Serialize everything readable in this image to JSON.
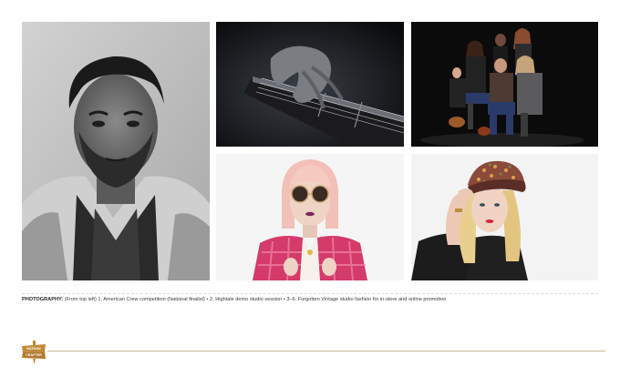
{
  "photos": [
    {
      "name": "photo-1-american-crew-portrait"
    },
    {
      "name": "photo-2-hightale-guitar"
    },
    {
      "name": "photo-3-forgotten-vintage-group"
    },
    {
      "name": "photo-4-forgotten-vintage-sunglasses"
    },
    {
      "name": "photo-5-forgotten-vintage-cap"
    }
  ],
  "caption": {
    "label": "PHOTOGRAPHY:",
    "text": " (From top left) 1. American Crew competition (National finalist) • 2. Hightale demo studio session • 3–6. Forgotten Vintage studio fashion for in-store and online promotion"
  },
  "logo": {
    "line1": "NATHAN",
    "line2": "CRAFTER"
  },
  "colors": {
    "accent": "#c9b48e",
    "logo": "#c08a3a"
  }
}
